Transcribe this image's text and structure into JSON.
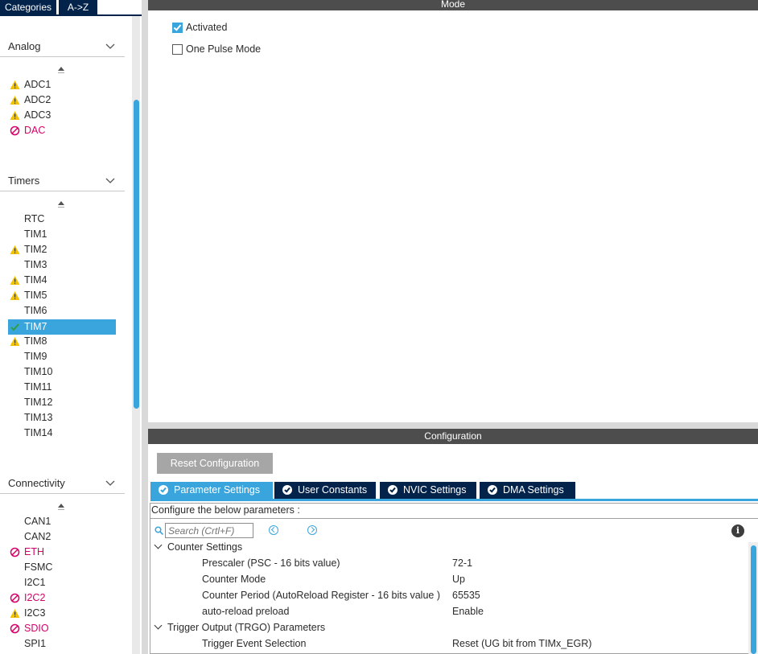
{
  "left_panel": {
    "tabs": {
      "categories": "Categories",
      "az": "A->Z"
    },
    "sections": [
      {
        "title": "Analog",
        "items": [
          {
            "label": "ADC1",
            "status": "warning"
          },
          {
            "label": "ADC2",
            "status": "warning"
          },
          {
            "label": "ADC3",
            "status": "warning"
          },
          {
            "label": "DAC",
            "status": "disabled"
          }
        ]
      },
      {
        "title": "Timers",
        "items": [
          {
            "label": "RTC",
            "status": "none"
          },
          {
            "label": "TIM1",
            "status": "none"
          },
          {
            "label": "TIM2",
            "status": "warning"
          },
          {
            "label": "TIM3",
            "status": "none"
          },
          {
            "label": "TIM4",
            "status": "warning"
          },
          {
            "label": "TIM5",
            "status": "warning"
          },
          {
            "label": "TIM6",
            "status": "none"
          },
          {
            "label": "TIM7",
            "status": "ok",
            "selected": true
          },
          {
            "label": "TIM8",
            "status": "warning"
          },
          {
            "label": "TIM9",
            "status": "none"
          },
          {
            "label": "TIM10",
            "status": "none"
          },
          {
            "label": "TIM11",
            "status": "none"
          },
          {
            "label": "TIM12",
            "status": "none"
          },
          {
            "label": "TIM13",
            "status": "none"
          },
          {
            "label": "TIM14",
            "status": "none"
          }
        ]
      },
      {
        "title": "Connectivity",
        "items": [
          {
            "label": "CAN1",
            "status": "none"
          },
          {
            "label": "CAN2",
            "status": "none"
          },
          {
            "label": "ETH",
            "status": "disabled"
          },
          {
            "label": "FSMC",
            "status": "none"
          },
          {
            "label": "I2C1",
            "status": "none"
          },
          {
            "label": "I2C2",
            "status": "disabled"
          },
          {
            "label": "I2C3",
            "status": "warning"
          },
          {
            "label": "SDIO",
            "status": "disabled"
          },
          {
            "label": "SPI1",
            "status": "none"
          }
        ]
      }
    ]
  },
  "mode": {
    "header": "Mode",
    "activated": {
      "label": "Activated",
      "checked": true
    },
    "one_pulse": {
      "label": "One Pulse Mode",
      "checked": false
    }
  },
  "configuration": {
    "header": "Configuration",
    "reset_button": "Reset Configuration",
    "tabs": [
      {
        "label": "Parameter Settings",
        "active": true
      },
      {
        "label": "User Constants",
        "active": false
      },
      {
        "label": "NVIC Settings",
        "active": false
      },
      {
        "label": "DMA Settings",
        "active": false
      }
    ],
    "description": "Configure the below parameters :",
    "search": {
      "placeholder": "Search (Crtl+F)",
      "value": ""
    },
    "groups": [
      {
        "title": "Counter Settings",
        "params": [
          {
            "name": "Prescaler (PSC - 16 bits value)",
            "value": "72-1"
          },
          {
            "name": "Counter Mode",
            "value": "Up"
          },
          {
            "name": "Counter Period (AutoReload Register - 16 bits value )",
            "value": "65535"
          },
          {
            "name": "auto-reload preload",
            "value": "Enable"
          }
        ]
      },
      {
        "title": "Trigger Output (TRGO) Parameters",
        "params": [
          {
            "name": "Trigger Event Selection",
            "value": "Reset (UG bit from TIMx_EGR)"
          }
        ]
      }
    ]
  },
  "colors": {
    "accent": "#3aa5dc",
    "navy": "#03234b",
    "header_gray": "#4d4d4d",
    "warning": "#f2c200",
    "disabled": "#d4006a",
    "ok": "#2e9e3a"
  }
}
